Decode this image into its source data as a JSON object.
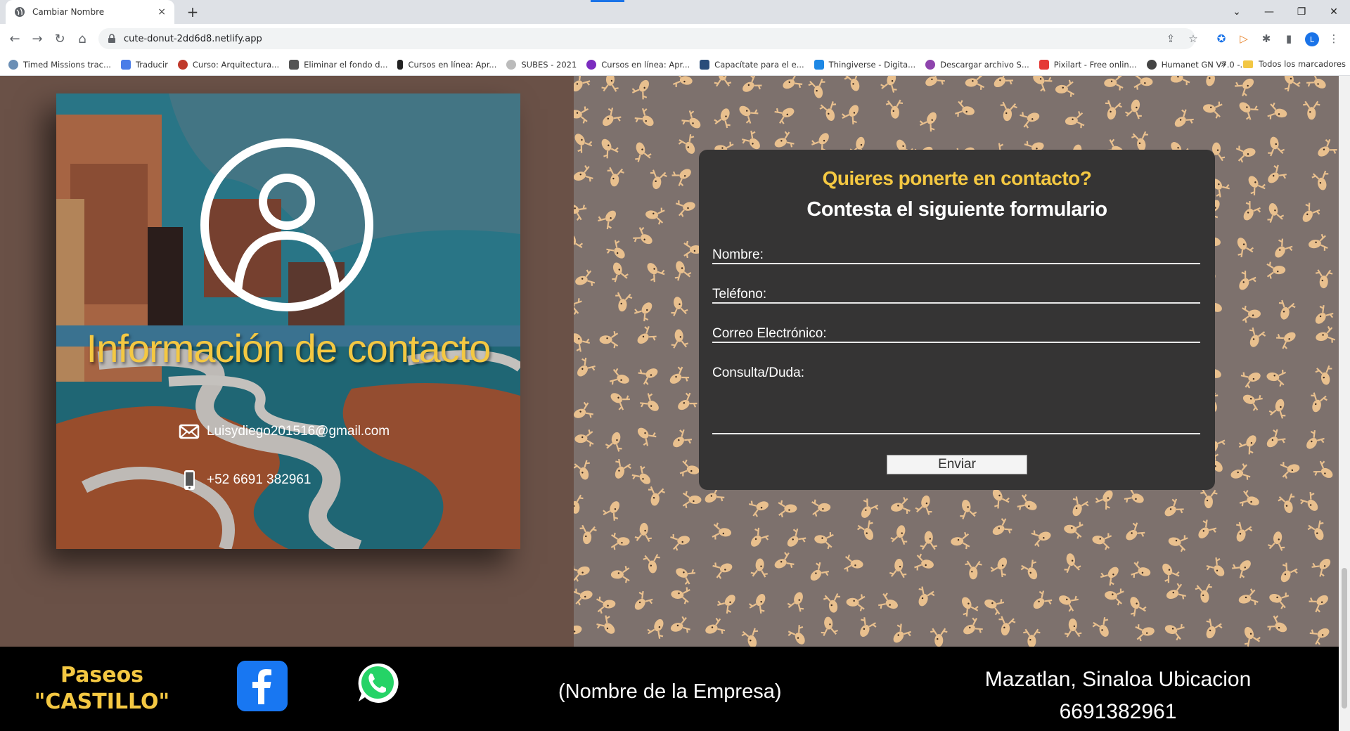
{
  "browser": {
    "tab_title": "Cambiar Nombre",
    "tab_close": "×",
    "new_tab": "+",
    "url": "cute-donut-2dd6d8.netlify.app",
    "avatar_letter": "L",
    "bookmarks": [
      {
        "label": "Timed Missions trac...",
        "color": "#6b8fb5"
      },
      {
        "label": "Traducir",
        "color": "#4a7de8"
      },
      {
        "label": "Curso: Arquitectura...",
        "color": "#c0392b"
      },
      {
        "label": "Eliminar el fondo d...",
        "color": "#555555"
      },
      {
        "label": "Cursos en línea: Apr...",
        "color": "#222222"
      },
      {
        "label": "SUBES - 2021",
        "color": "#bbbbbb"
      },
      {
        "label": "Cursos en línea: Apr...",
        "color": "#7b2cbf"
      },
      {
        "label": "Capacítate para el e...",
        "color": "#2a4d7a"
      },
      {
        "label": "Thingiverse - Digita...",
        "color": "#1e88e5"
      },
      {
        "label": "Descargar archivo S...",
        "color": "#8e44ad"
      },
      {
        "label": "Pixilart - Free onlin...",
        "color": "#e53935"
      },
      {
        "label": "Humanet GN V7.0 -...",
        "color": "#444444"
      }
    ],
    "bookmarks_more": "»",
    "all_bookmarks": "Todos los marcadores"
  },
  "contact_card": {
    "title": "Información de contacto",
    "email": "Luisydiego201516@gmail.com",
    "phone": "+52 6691 382961"
  },
  "form": {
    "question": "Quieres ponerte en contacto?",
    "subtitle": "Contesta el siguiente formulario",
    "name_label": "Nombre:",
    "phone_label": "Teléfono:",
    "email_label": "Correo Electrónico:",
    "message_label": "Consulta/Duda:",
    "submit_label": "Enviar"
  },
  "footer": {
    "brand_line1": "Paseos",
    "brand_line2": "\"CASTILLO\"",
    "company": "(Nombre de la Empresa)",
    "location": "Mazatlan, Sinaloa Ubicacion",
    "phone": "6691382961"
  },
  "colors": {
    "accent_yellow": "#f4c842",
    "form_bg": "#353434",
    "facebook_blue": "#1877f2",
    "whatsapp_green": "#25d366"
  },
  "icons": [
    "globe-icon",
    "lock-icon",
    "share-icon",
    "star-icon",
    "extensions-icon",
    "sidebar-icon",
    "user-profile-icon",
    "mail-icon",
    "phone-icon",
    "facebook-icon",
    "whatsapp-icon"
  ]
}
